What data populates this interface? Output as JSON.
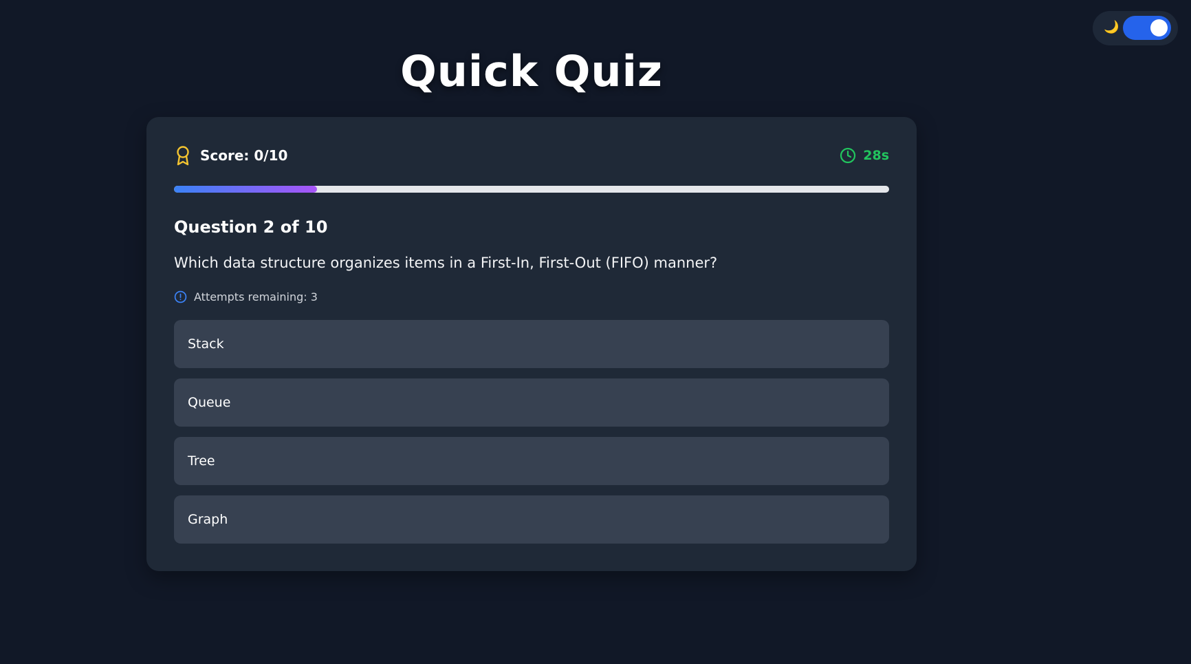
{
  "theme_toggle": {
    "icon": "moon-icon",
    "glyph": "🌙",
    "enabled": true,
    "accent": "#2563eb"
  },
  "title": "Quick Quiz",
  "score": {
    "label": "Score: 0/10",
    "icon": "award-icon",
    "icon_color": "#f4c430"
  },
  "timer": {
    "label": "28s",
    "icon": "clock-icon",
    "color": "#22c55e"
  },
  "progress": {
    "fraction": 0.2,
    "gradient": [
      "#3b82f6",
      "#a855f7"
    ]
  },
  "question": {
    "number_label": "Question 2 of 10",
    "text": "Which data structure organizes items in a First-In, First-Out (FIFO) manner?"
  },
  "attempts": {
    "label": "Attempts remaining: 3",
    "icon": "alert-circle-icon",
    "icon_color": "#3b82f6"
  },
  "options": [
    {
      "label": "Stack"
    },
    {
      "label": "Queue"
    },
    {
      "label": "Tree"
    },
    {
      "label": "Graph"
    }
  ]
}
